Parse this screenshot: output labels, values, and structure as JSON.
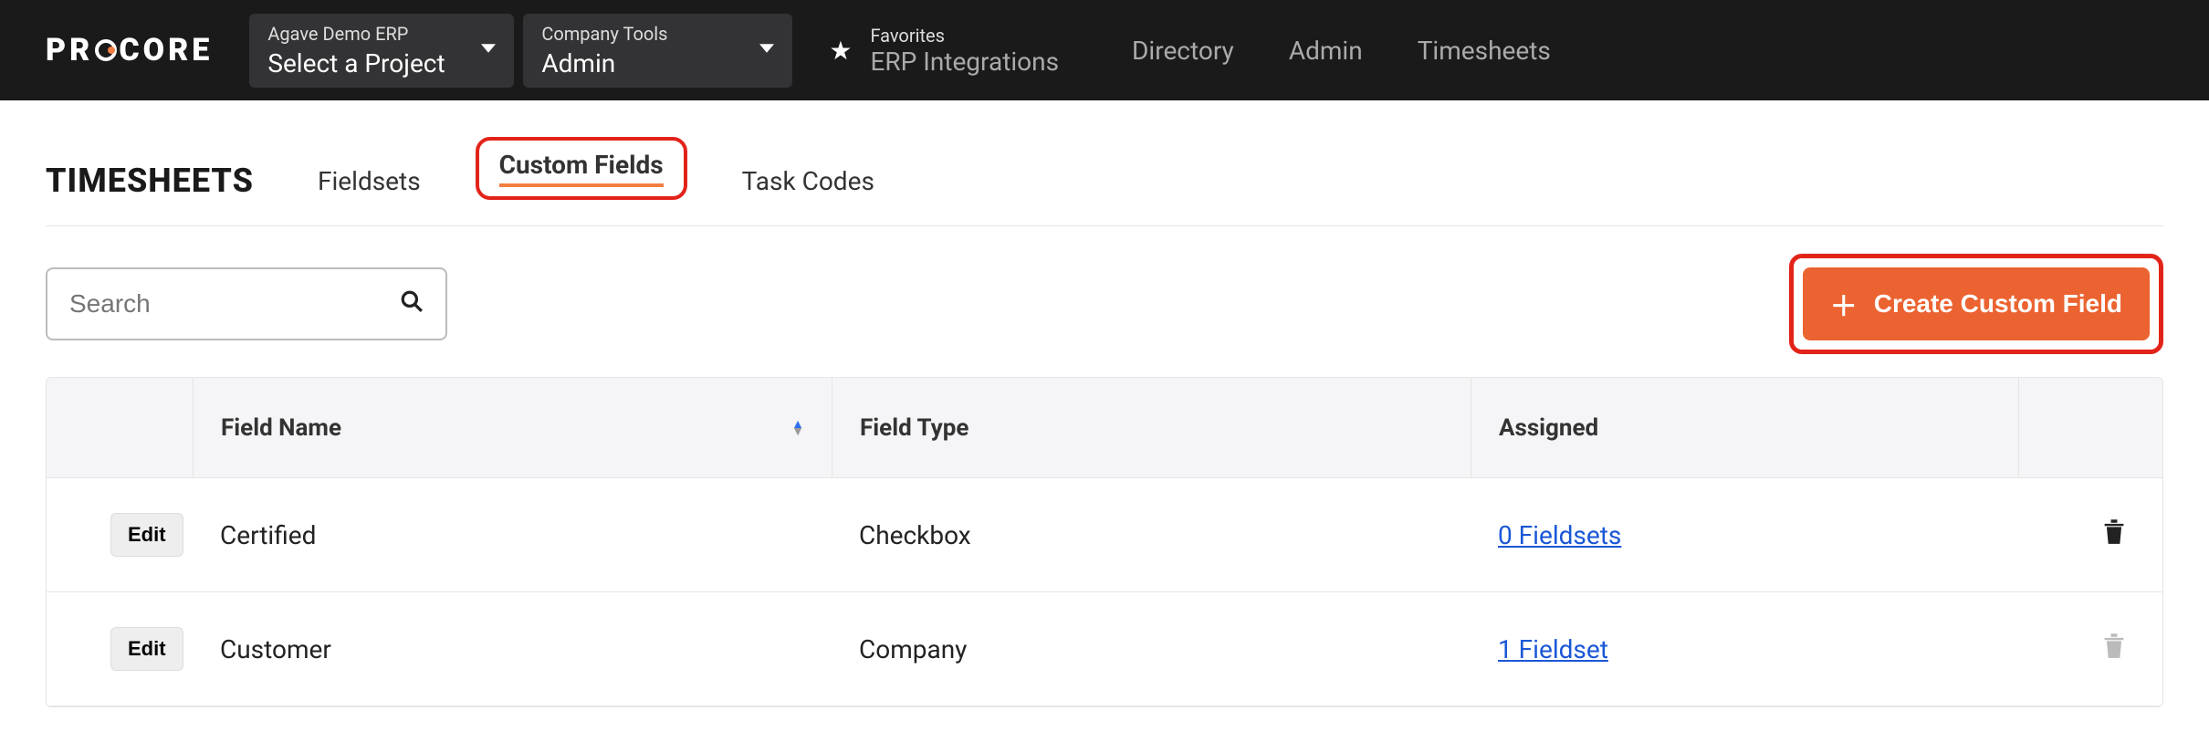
{
  "brand": "PROCORE",
  "nav": {
    "project": {
      "sub": "Agave Demo ERP",
      "main": "Select a Project"
    },
    "tools": {
      "sub": "Company Tools",
      "main": "Admin"
    },
    "favorites": {
      "label": "Favorites",
      "primary": "ERP Integrations"
    },
    "links": [
      "Directory",
      "Admin",
      "Timesheets"
    ]
  },
  "page": {
    "title": "TIMESHEETS",
    "tabs": [
      {
        "label": "Fieldsets",
        "active": false
      },
      {
        "label": "Custom Fields",
        "active": true
      },
      {
        "label": "Task Codes",
        "active": false
      }
    ]
  },
  "toolbar": {
    "search_placeholder": "Search",
    "create_label": "Create Custom Field"
  },
  "table": {
    "columns": {
      "edit": "Edit",
      "field_name": "Field Name",
      "field_type": "Field Type",
      "assigned": "Assigned"
    },
    "rows": [
      {
        "name": "Certified",
        "type": "Checkbox",
        "assigned": "0 Fieldsets",
        "deletable": true
      },
      {
        "name": "Customer",
        "type": "Company",
        "assigned": "1 Fieldset",
        "deletable": false
      }
    ]
  }
}
